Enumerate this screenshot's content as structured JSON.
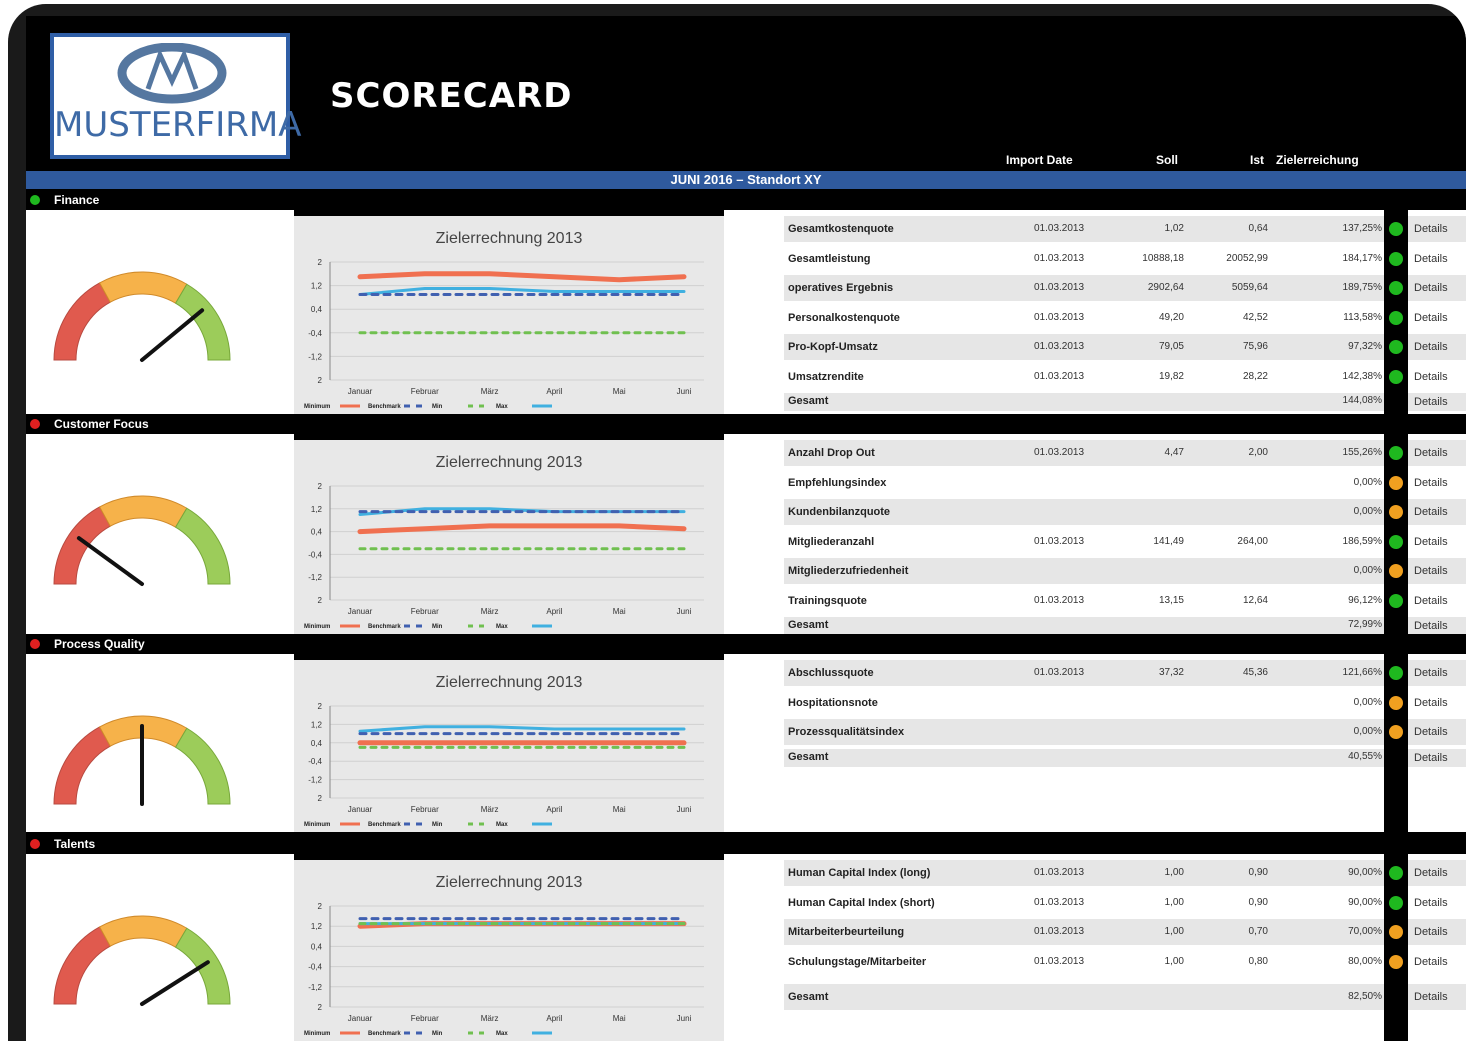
{
  "header": {
    "logo_text": "MUSTERFIRMA",
    "title": "SCORECARD",
    "banner": "JUNI 2016 – Standort XY",
    "columns": {
      "import_date": "Import Date",
      "soll": "Soll",
      "ist": "Ist",
      "zielerreichung": "Zielerreichung"
    }
  },
  "colors": {
    "green": "#1fb81f",
    "red": "#e02020",
    "orange": "#f0a020",
    "blue": "#2f5a9e"
  },
  "chart_common": {
    "title": "Zielerrechnung 2013",
    "y_ticks": [
      "2",
      "1,2",
      "0,4",
      "-0,4",
      "-1,2",
      "2"
    ],
    "months": [
      "Januar",
      "Februar",
      "März",
      "April",
      "Mai",
      "Juni"
    ],
    "legend": [
      "Minimum",
      "Benchmark",
      "Min",
      "Max"
    ]
  },
  "details_label": "Details",
  "sections": [
    {
      "name": "Finance",
      "status": "green",
      "gauge_value": 0.78,
      "chart": {
        "type": "line",
        "series": [
          {
            "name": "Minimum",
            "values": [
              1.5,
              1.6,
              1.6,
              1.5,
              1.4,
              1.5
            ]
          },
          {
            "name": "Max",
            "values": [
              0.9,
              1.1,
              1.1,
              1.0,
              1.0,
              1.0
            ]
          },
          {
            "name": "Benchmark",
            "values": [
              0.9,
              0.9,
              0.9,
              0.9,
              0.9,
              0.9
            ]
          },
          {
            "name": "Min",
            "values": [
              -0.4,
              -0.4,
              -0.4,
              -0.4,
              -0.4,
              -0.4
            ]
          }
        ]
      },
      "rows": [
        {
          "name": "Gesamtkostenquote",
          "date": "01.03.2013",
          "soll": "1,02",
          "ist": "0,64",
          "pct": "137,25%",
          "status": "green"
        },
        {
          "name": "Gesamtleistung",
          "date": "01.03.2013",
          "soll": "10888,18",
          "ist": "20052,99",
          "pct": "184,17%",
          "status": "green"
        },
        {
          "name": "operatives Ergebnis",
          "date": "01.03.2013",
          "soll": "2902,64",
          "ist": "5059,64",
          "pct": "189,75%",
          "status": "green"
        },
        {
          "name": "Personalkostenquote",
          "date": "01.03.2013",
          "soll": "49,20",
          "ist": "42,52",
          "pct": "113,58%",
          "status": "green"
        },
        {
          "name": "Pro-Kopf-Umsatz",
          "date": "01.03.2013",
          "soll": "79,05",
          "ist": "75,96",
          "pct": "97,32%",
          "status": "green"
        },
        {
          "name": "Umsatzrendite",
          "date": "01.03.2013",
          "soll": "19,82",
          "ist": "28,22",
          "pct": "142,38%",
          "status": "green"
        },
        {
          "name": "Gesamt",
          "date": "",
          "soll": "",
          "ist": "",
          "pct": "144,08%",
          "status": "none"
        }
      ]
    },
    {
      "name": "Customer Focus",
      "status": "red",
      "gauge_value": 0.2,
      "chart": {
        "type": "line",
        "series": [
          {
            "name": "Minimum",
            "values": [
              0.4,
              0.5,
              0.6,
              0.6,
              0.6,
              0.5
            ]
          },
          {
            "name": "Max",
            "values": [
              1.0,
              1.2,
              1.2,
              1.1,
              1.1,
              1.1
            ]
          },
          {
            "name": "Benchmark",
            "values": [
              1.1,
              1.1,
              1.1,
              1.1,
              1.1,
              1.1
            ]
          },
          {
            "name": "Min",
            "values": [
              -0.2,
              -0.2,
              -0.2,
              -0.2,
              -0.2,
              -0.2
            ]
          }
        ]
      },
      "rows": [
        {
          "name": "Anzahl Drop Out",
          "date": "01.03.2013",
          "soll": "4,47",
          "ist": "2,00",
          "pct": "155,26%",
          "status": "green"
        },
        {
          "name": "Empfehlungsindex",
          "date": "",
          "soll": "",
          "ist": "",
          "pct": "0,00%",
          "status": "orange"
        },
        {
          "name": "Kundenbilanzquote",
          "date": "",
          "soll": "",
          "ist": "",
          "pct": "0,00%",
          "status": "orange"
        },
        {
          "name": "Mitgliederanzahl",
          "date": "01.03.2013",
          "soll": "141,49",
          "ist": "264,00",
          "pct": "186,59%",
          "status": "green"
        },
        {
          "name": "Mitgliederzufriedenheit",
          "date": "",
          "soll": "",
          "ist": "",
          "pct": "0,00%",
          "status": "orange"
        },
        {
          "name": "Trainingsquote",
          "date": "01.03.2013",
          "soll": "13,15",
          "ist": "12,64",
          "pct": "96,12%",
          "status": "green"
        },
        {
          "name": "Gesamt",
          "date": "",
          "soll": "",
          "ist": "",
          "pct": "72,99%",
          "status": "none"
        }
      ]
    },
    {
      "name": "Process Quality",
      "status": "red",
      "gauge_value": 0.5,
      "chart": {
        "type": "line",
        "series": [
          {
            "name": "Minimum",
            "values": [
              0.4,
              0.4,
              0.4,
              0.4,
              0.4,
              0.4
            ]
          },
          {
            "name": "Max",
            "values": [
              0.9,
              1.1,
              1.1,
              1.0,
              1.0,
              1.0
            ]
          },
          {
            "name": "Benchmark",
            "values": [
              0.8,
              0.8,
              0.8,
              0.8,
              0.8,
              0.8
            ]
          },
          {
            "name": "Min",
            "values": [
              0.2,
              0.2,
              0.2,
              0.2,
              0.2,
              0.2
            ]
          }
        ]
      },
      "rows": [
        {
          "name": "Abschlussquote",
          "date": "01.03.2013",
          "soll": "37,32",
          "ist": "45,36",
          "pct": "121,66%",
          "status": "green"
        },
        {
          "name": "Hospitationsnote",
          "date": "",
          "soll": "",
          "ist": "",
          "pct": "0,00%",
          "status": "orange"
        },
        {
          "name": "Prozessqualitätsindex",
          "date": "",
          "soll": "",
          "ist": "",
          "pct": "0,00%",
          "status": "orange"
        },
        {
          "name": "Gesamt",
          "date": "",
          "soll": "",
          "ist": "",
          "pct": "40,55%",
          "status": "none"
        }
      ]
    },
    {
      "name": "Talents",
      "status": "red",
      "gauge_value": 0.82,
      "chart": {
        "type": "line",
        "series": [
          {
            "name": "Minimum",
            "values": [
              1.2,
              1.3,
              1.3,
              1.3,
              1.3,
              1.3
            ]
          },
          {
            "name": "Max",
            "values": [
              1.3,
              1.3,
              1.3,
              1.3,
              1.3,
              1.3
            ]
          },
          {
            "name": "Benchmark",
            "values": [
              1.5,
              1.5,
              1.5,
              1.5,
              1.5,
              1.5
            ]
          },
          {
            "name": "Min",
            "values": [
              1.3,
              1.3,
              1.3,
              1.3,
              1.3,
              1.3
            ]
          }
        ]
      },
      "rows": [
        {
          "name": "Human Capital Index (long)",
          "date": "01.03.2013",
          "soll": "1,00",
          "ist": "0,90",
          "pct": "90,00%",
          "status": "green"
        },
        {
          "name": "Human Capital Index (short)",
          "date": "01.03.2013",
          "soll": "1,00",
          "ist": "0,90",
          "pct": "90,00%",
          "status": "green"
        },
        {
          "name": "Mitarbeiterbeurteilung",
          "date": "01.03.2013",
          "soll": "1,00",
          "ist": "0,70",
          "pct": "70,00%",
          "status": "orange"
        },
        {
          "name": "Schulungstage/Mitarbeiter",
          "date": "01.03.2013",
          "soll": "1,00",
          "ist": "0,80",
          "pct": "80,00%",
          "status": "orange"
        },
        {
          "name": "Gesamt",
          "date": "",
          "soll": "",
          "ist": "",
          "pct": "82,50%",
          "status": "none"
        }
      ]
    }
  ]
}
